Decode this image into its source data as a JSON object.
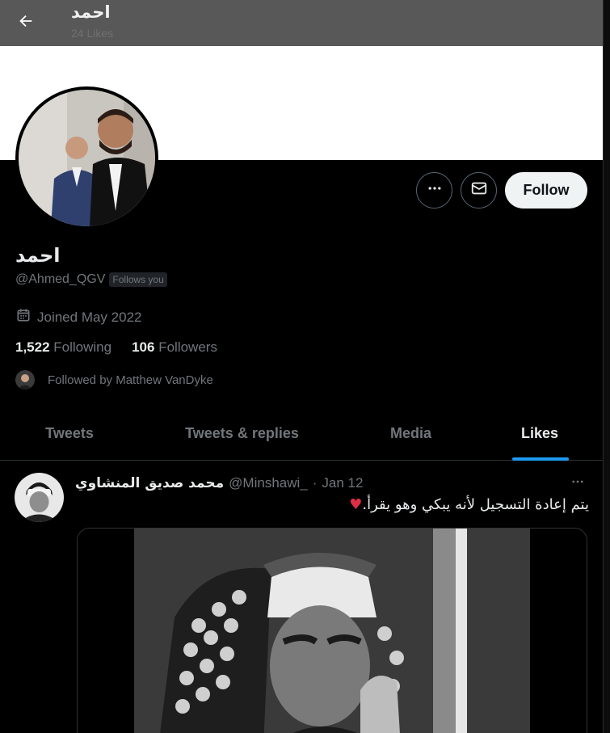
{
  "header": {
    "title": "احمد",
    "subtitle": "24 Likes"
  },
  "profile": {
    "display_name": "احمد",
    "handle": "@Ahmed_QGV",
    "follows_you_badge": "Follows you",
    "joined": "Joined May 2022",
    "following_count": "1,522",
    "following_label": "Following",
    "followers_count": "106",
    "followers_label": "Followers",
    "followed_by": "Followed by Matthew VanDyke"
  },
  "actions": {
    "follow_label": "Follow",
    "more_icon": "more-horizontal-icon",
    "message_icon": "envelope-icon"
  },
  "tabs": [
    {
      "label": "Tweets",
      "active": false
    },
    {
      "label": "Tweets & replies",
      "active": false
    },
    {
      "label": "Media",
      "active": false
    },
    {
      "label": "Likes",
      "active": true
    }
  ],
  "tweet": {
    "author": "محمد صديق المنشاوي",
    "handle": "@Minshawi_",
    "separator": "·",
    "date": "Jan 12",
    "text": "يتم إعادة التسجيل لأنه يبكي وهو يقرأ.",
    "emoji": "♥"
  },
  "colors": {
    "accent": "#1d9bf0",
    "background": "#000000",
    "text_primary": "#e7e9ea",
    "text_secondary": "#71767b",
    "border": "#2f3336",
    "heart": "#dd2e44"
  }
}
